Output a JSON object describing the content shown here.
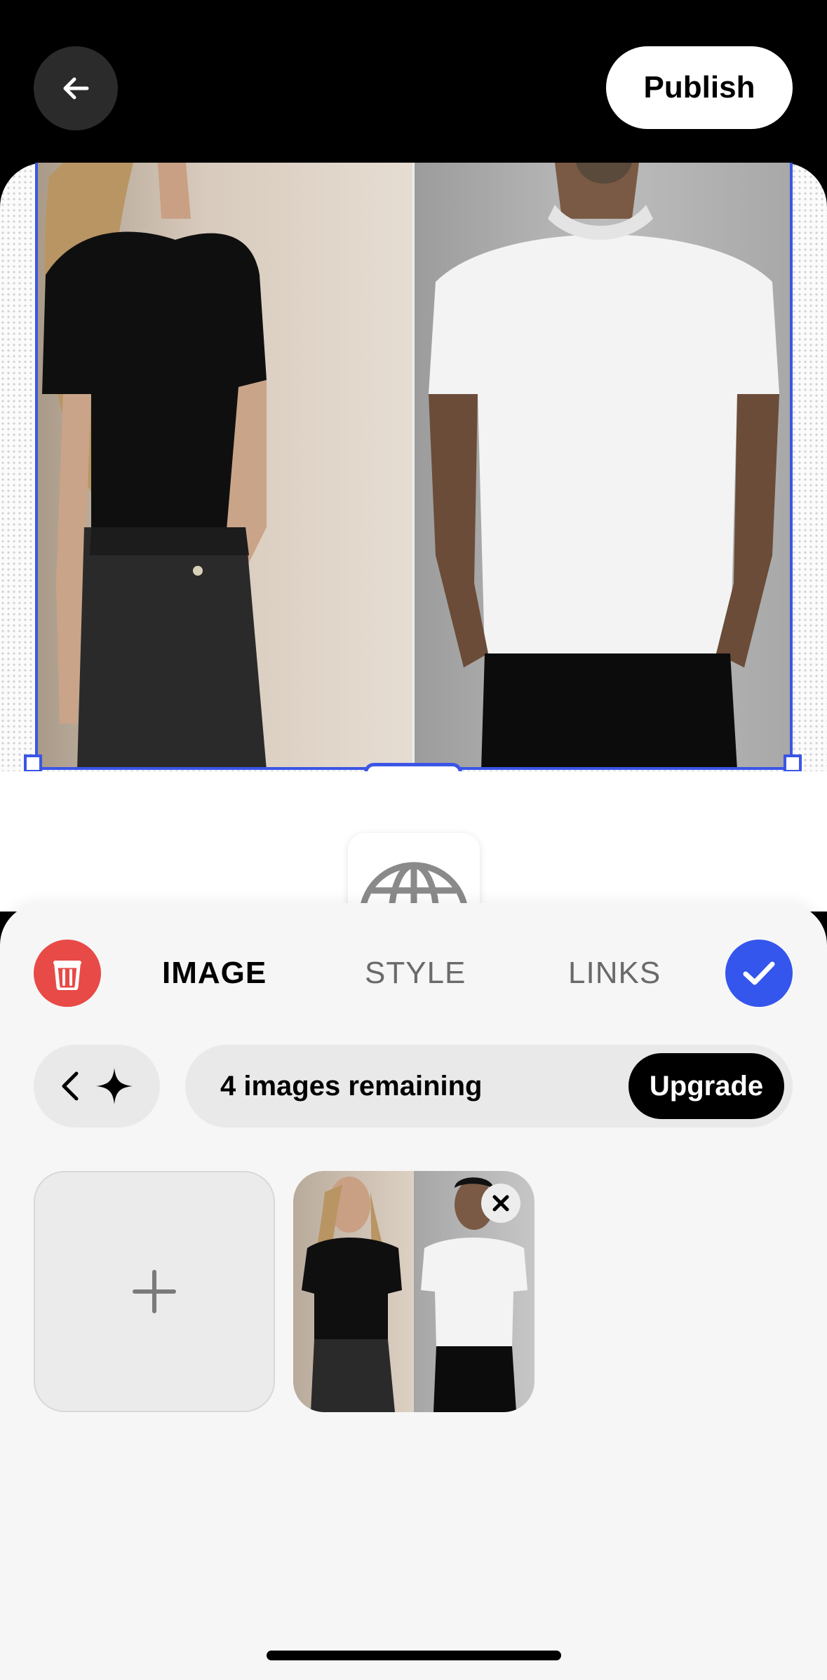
{
  "header": {
    "publish_label": "Publish"
  },
  "editor": {
    "tabs": [
      {
        "label": "IMAGE",
        "active": true
      },
      {
        "label": "STYLE",
        "active": false
      },
      {
        "label": "LINKS",
        "active": false
      }
    ]
  },
  "quota": {
    "remaining_text": "4 images remaining",
    "upgrade_label": "Upgrade"
  },
  "icons": {
    "back": "arrow-left-icon",
    "delete": "trash-icon",
    "confirm": "checkmark-icon",
    "nav_back": "chevron-left-icon",
    "ai": "sparkle-icon",
    "add": "plus-icon",
    "remove": "close-icon",
    "link_type": "globe-icon"
  },
  "colors": {
    "accent": "#3456ec",
    "selection": "#3b55e6",
    "danger": "#e84a47",
    "publish_bg": "#ffffff",
    "sheet_bg": "#f6f6f6"
  }
}
